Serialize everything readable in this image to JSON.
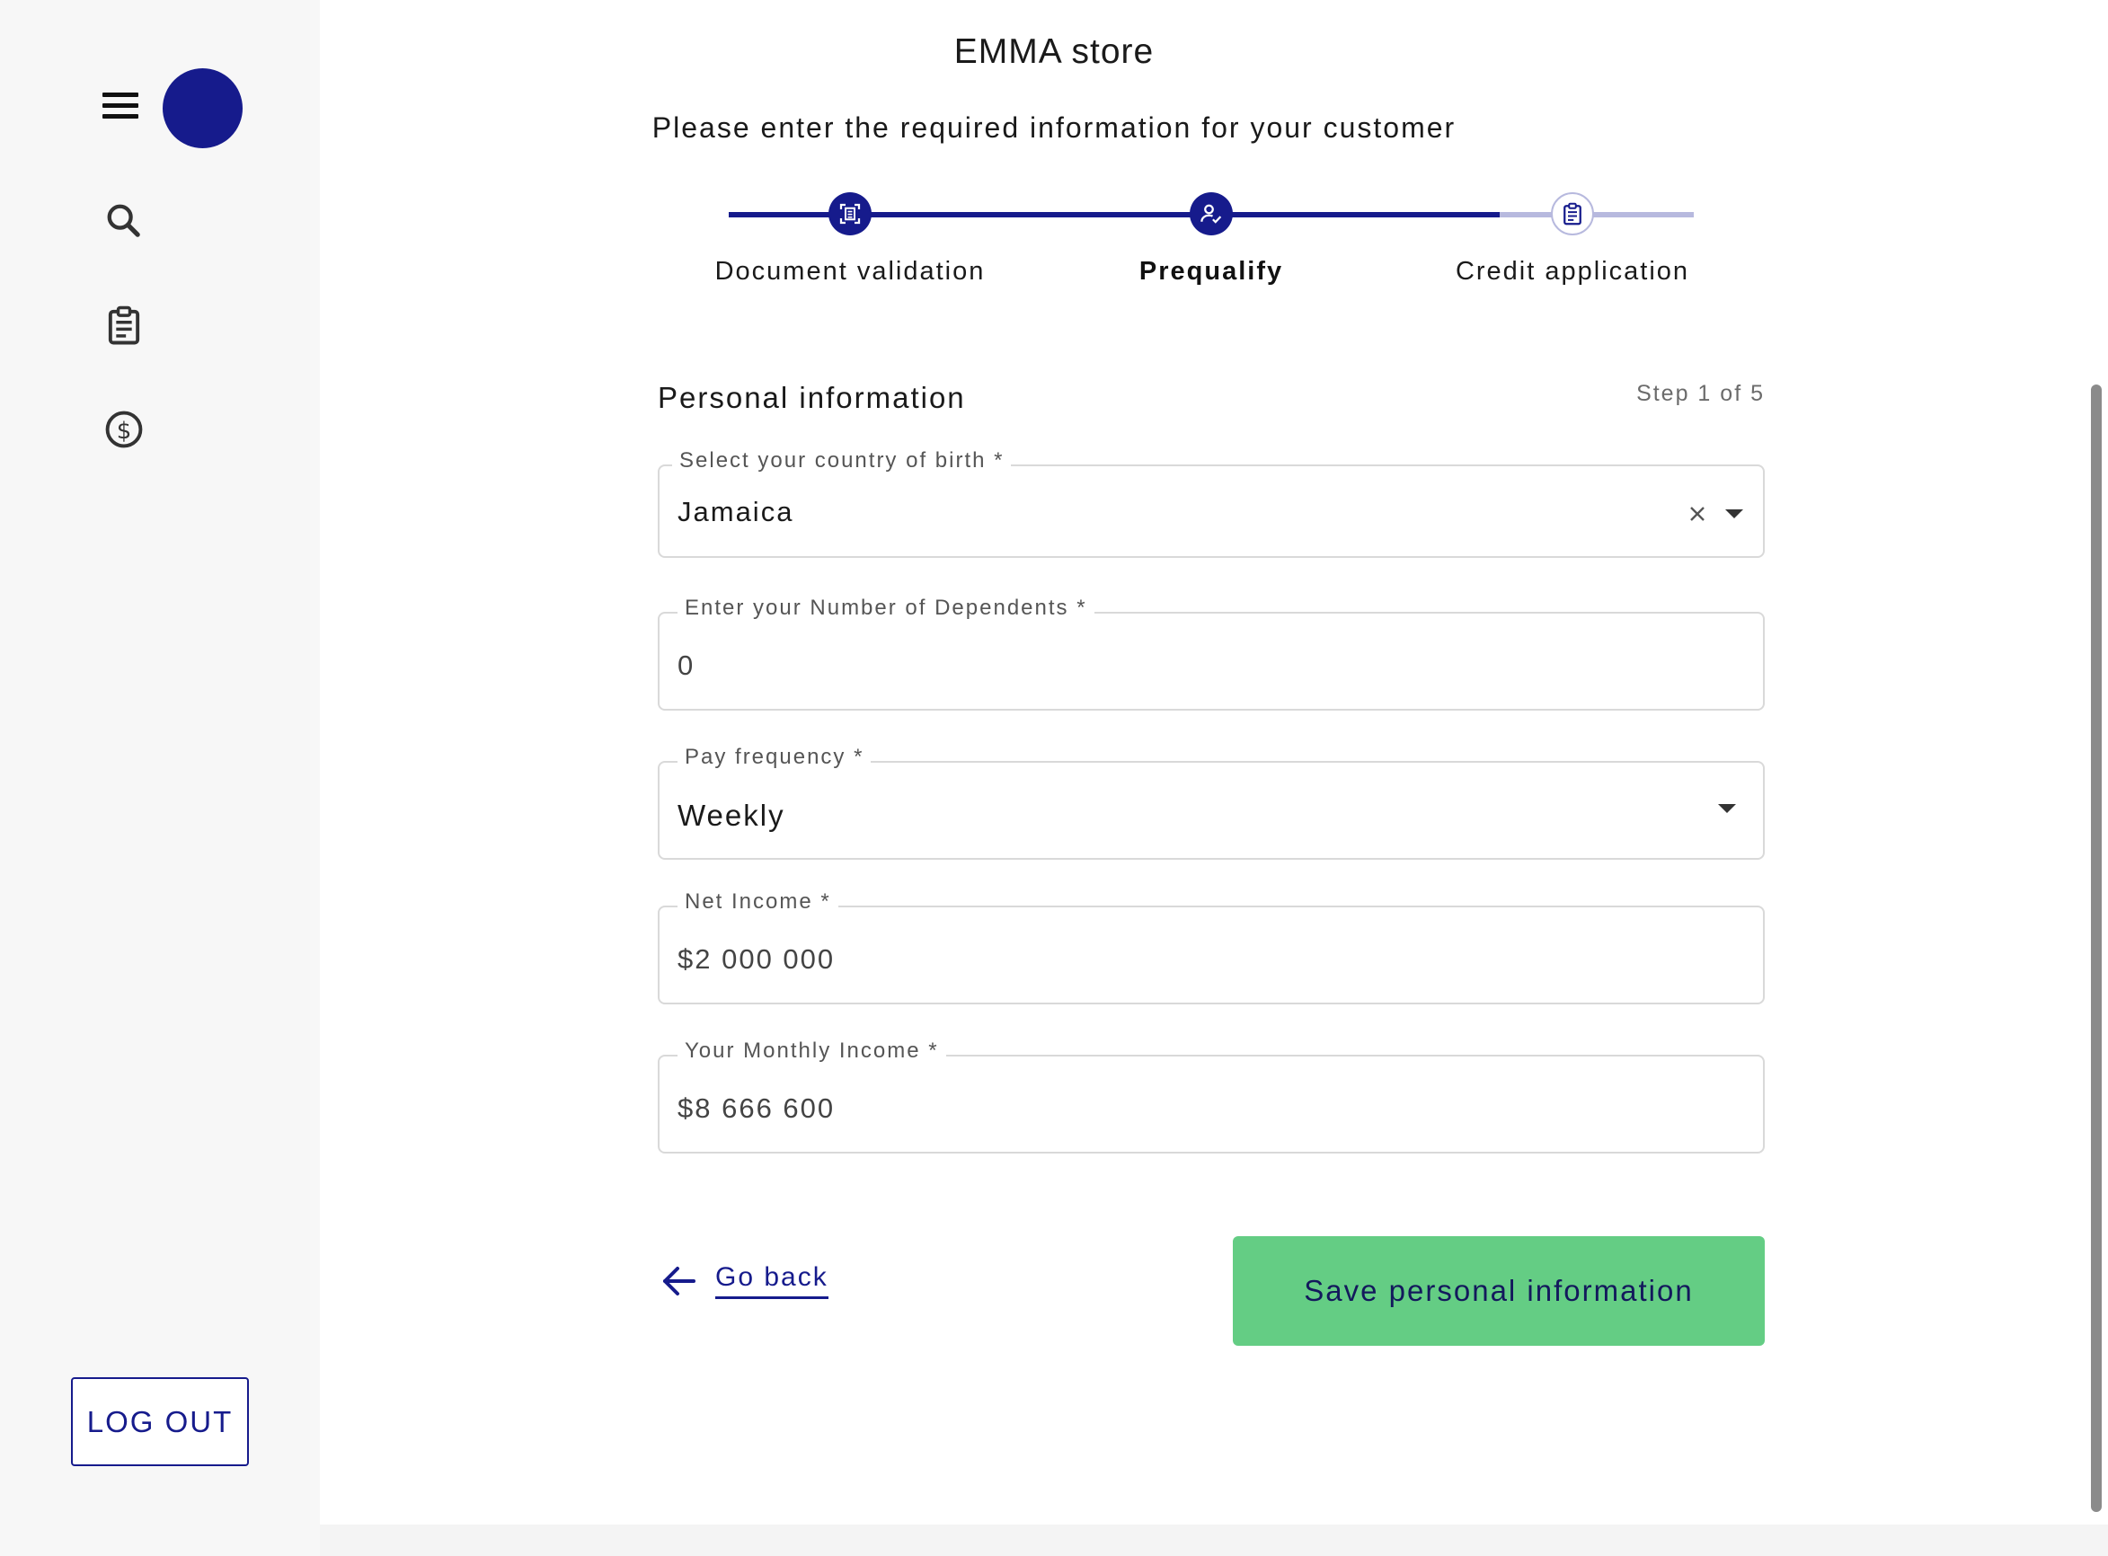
{
  "sidebar": {
    "menu_icon": "hamburger-menu-icon",
    "avatar_color": "#161b8c",
    "nav_icons": [
      "search-icon",
      "clipboard-icon",
      "dollar-circle-icon"
    ],
    "logout_label": "LOG OUT"
  },
  "header": {
    "store_name": "EMMA store",
    "instruction": "Please enter the required information for your customer"
  },
  "stepper": {
    "steps": [
      {
        "label": "Document validation",
        "icon": "document-scan-icon",
        "state": "complete"
      },
      {
        "label": "Prequalify",
        "icon": "user-check-icon",
        "state": "active"
      },
      {
        "label": "Credit application",
        "icon": "clipboard-icon",
        "state": "upcoming"
      }
    ]
  },
  "form": {
    "section_title": "Personal information",
    "step_count": "Step 1 of 5",
    "fields": [
      {
        "label": "Select your country of birth *",
        "value": "Jamaica",
        "type": "autocomplete"
      },
      {
        "label": "Enter your Number of Dependents *",
        "value": "0",
        "type": "number"
      },
      {
        "label": "Pay frequency *",
        "value": "Weekly",
        "type": "select"
      },
      {
        "label": "Net Income *",
        "value": "$2 000 000",
        "type": "text"
      },
      {
        "label": "Your Monthly Income *",
        "value": "$8 666 600",
        "type": "text"
      }
    ],
    "go_back_label": "Go back",
    "save_label": "Save personal information"
  },
  "colors": {
    "primary": "#161b8c",
    "primary_light": "#b7b9de",
    "success": "#64cd84",
    "sidebar_bg": "#f7f7f7"
  }
}
